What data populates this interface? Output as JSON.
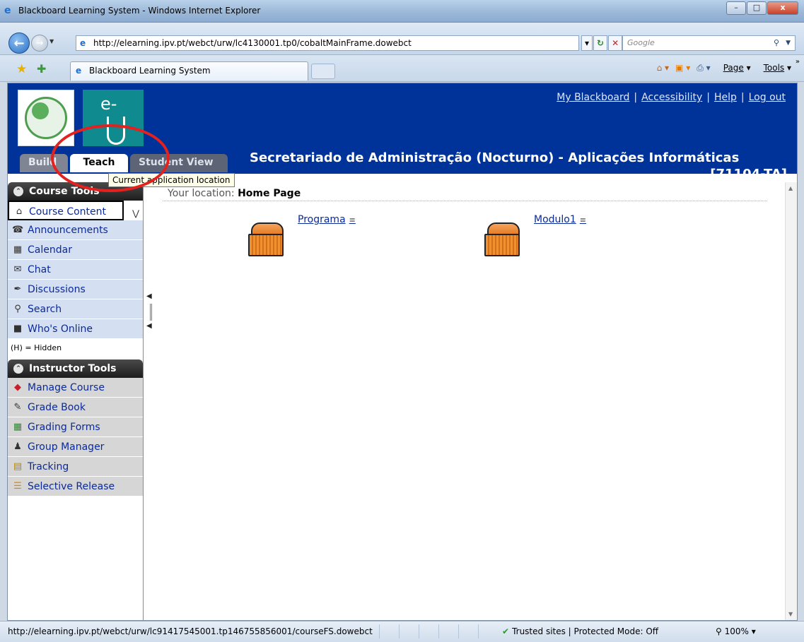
{
  "window": {
    "title": "Blackboard Learning System - Windows Internet Explorer",
    "minimize": "–",
    "maximize": "□",
    "close": "x"
  },
  "address": {
    "url": "http://elearning.ipv.pt/webct/urw/lc4130001.tp0/cobaltMainFrame.dowebct",
    "search_placeholder": "Google"
  },
  "tab": {
    "label": "Blackboard Learning System"
  },
  "commandbar": {
    "page": "Page",
    "tools": "Tools"
  },
  "header": {
    "links": [
      "My Blackboard",
      "Accessibility",
      "Help",
      "Log out"
    ],
    "course_title": "Secretariado de Administração (Nocturno) - Aplicações Informáticas",
    "course_code": "[71104-TA]",
    "tabs": [
      "Build",
      "Teach",
      "Student View"
    ],
    "tooltip": "Current application location"
  },
  "course_tools": {
    "title": "Course Tools",
    "items": [
      {
        "label": "Course Content",
        "icon": "home-icon"
      },
      {
        "label": "Announcements",
        "icon": "megaphone-icon"
      },
      {
        "label": "Calendar",
        "icon": "calendar-icon"
      },
      {
        "label": "Chat",
        "icon": "chat-icon"
      },
      {
        "label": "Discussions",
        "icon": "pin-icon"
      },
      {
        "label": "Search",
        "icon": "search-icon"
      },
      {
        "label": "Who's Online",
        "icon": "person-icon"
      }
    ],
    "hidden_note": "(H) = Hidden"
  },
  "instructor_tools": {
    "title": "Instructor Tools",
    "items": [
      {
        "label": "Manage Course",
        "icon": "toolbox-icon"
      },
      {
        "label": "Grade Book",
        "icon": "gradebook-icon"
      },
      {
        "label": "Grading Forms",
        "icon": "grid-icon"
      },
      {
        "label": "Group Manager",
        "icon": "group-icon"
      },
      {
        "label": "Tracking",
        "icon": "chart-icon"
      },
      {
        "label": "Selective Release",
        "icon": "release-icon"
      }
    ]
  },
  "main": {
    "location_label": "Your location:",
    "location_value": "Home Page",
    "folders": [
      "Programa",
      "Modulo1"
    ]
  },
  "status": {
    "url": "http://elearning.ipv.pt/webct/urw/lc91417545001.tp146755856001/courseFS.dowebct",
    "zone": "Trusted sites | Protected Mode: Off",
    "zoom": "100%"
  }
}
